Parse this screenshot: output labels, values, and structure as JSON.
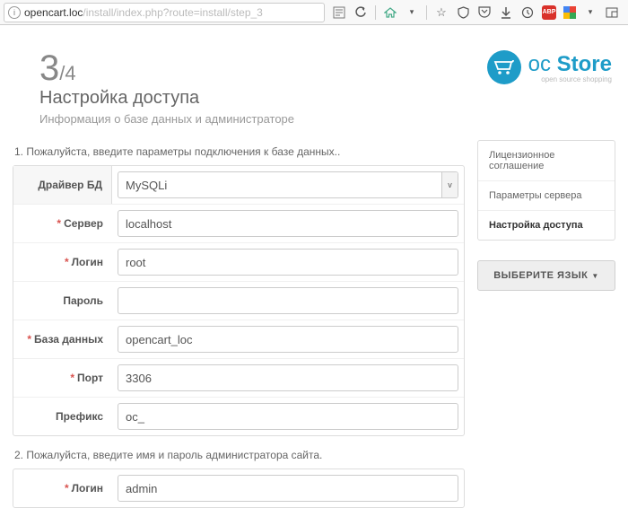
{
  "browser": {
    "url_prefix": "opencart.loc",
    "url_suffix": "/install/index.php?route=install/step_3"
  },
  "header": {
    "step_current": "3",
    "step_total": "/4",
    "title": "Настройка доступа",
    "description": "Информация о базе данных и администраторе"
  },
  "logo": {
    "text1": "oc",
    "text2": "Store",
    "sub": "open source shopping"
  },
  "section1": {
    "title": "1. Пожалуйста, введите параметры подключения к базе данных..",
    "driver_label": "Драйвер БД",
    "driver_value": "MySQLi",
    "host_label": "Сервер",
    "host_value": "localhost",
    "user_label": "Логин",
    "user_value": "root",
    "password_label": "Пароль",
    "password_value": "",
    "db_label": "База данных",
    "db_value": "opencart_loc",
    "port_label": "Порт",
    "port_value": "3306",
    "prefix_label": "Префикс",
    "prefix_value": "oc_"
  },
  "section2": {
    "title": "2. Пожалуйста, введите имя и пароль администратора сайта.",
    "login_label": "Логин",
    "login_value": "admin"
  },
  "sidebar": {
    "items": [
      {
        "label": "Лицензионное соглашение"
      },
      {
        "label": "Параметры сервера"
      },
      {
        "label": "Настройка доступа"
      }
    ],
    "active_index": 2,
    "lang_button": "ВЫБЕРИТЕ ЯЗЫК"
  }
}
